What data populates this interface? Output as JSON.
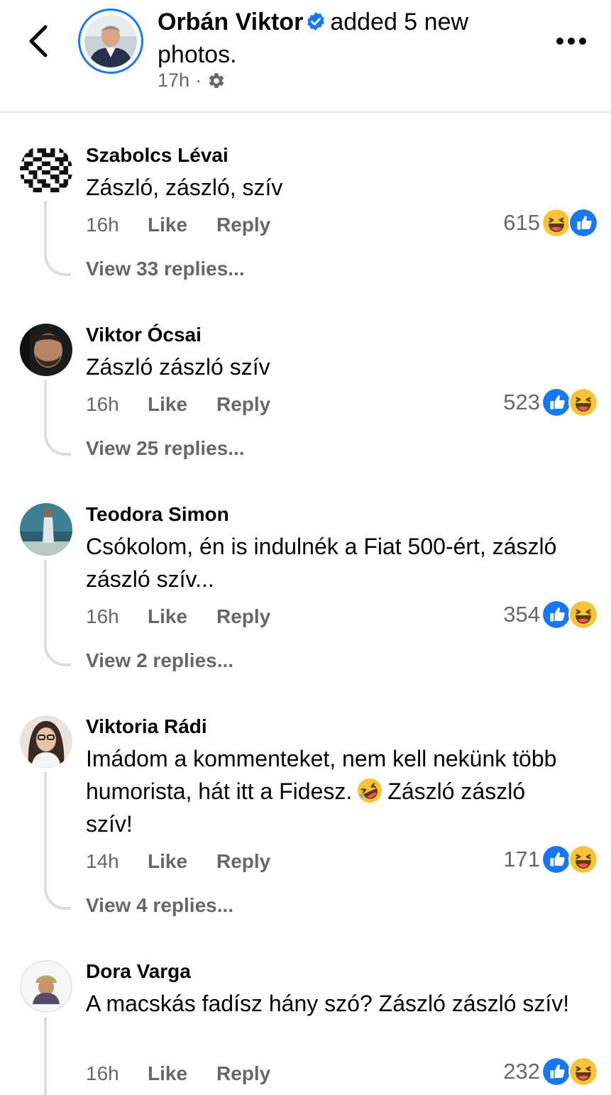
{
  "header": {
    "author": "Orbán Viktor",
    "action_text": "added 5 new photos.",
    "time": "17h",
    "separator": "·",
    "icons": [
      "back-chevron-icon",
      "verified-badge-icon",
      "audience-gear-icon",
      "more-dots-icon"
    ]
  },
  "colors": {
    "accent": "#1877f2",
    "secondary_text": "#65676b",
    "thread_line": "#dadde1"
  },
  "comments": [
    {
      "name": "Szabolcs Lévai",
      "text": "Zászló, zászló, szív",
      "time": "16h",
      "like": "Like",
      "reply": "Reply",
      "reactions": "615",
      "reaction_icons": [
        "haha",
        "like"
      ],
      "view_replies": "View 33 replies..."
    },
    {
      "name": "Viktor Ócsai",
      "text": "Zászló zászló szív",
      "time": "16h",
      "like": "Like",
      "reply": "Reply",
      "reactions": "523",
      "reaction_icons": [
        "like",
        "haha"
      ],
      "view_replies": "View 25 replies..."
    },
    {
      "name": "Teodora Simon",
      "text": "Csókolom, én is indulnék a Fiat 500-ért, zászló zászló szív...",
      "time": "16h",
      "like": "Like",
      "reply": "Reply",
      "reactions": "354",
      "reaction_icons": [
        "like",
        "haha"
      ],
      "view_replies": "View 2 replies..."
    },
    {
      "name": "Viktoria Rádi",
      "text_before_emoji": "Imádom a kommenteket, nem kell nekünk több humorista, hát itt a Fidesz.",
      "inline_emoji": "rolling-on-floor-laughing",
      "text_after_emoji": "Zászló zászló szív!",
      "time": "14h",
      "like": "Like",
      "reply": "Reply",
      "reactions": "171",
      "reaction_icons": [
        "like",
        "haha"
      ],
      "view_replies": "View 4 replies..."
    },
    {
      "name": "Dora Varga",
      "text": "A macskás fadísz hány szó? Zászló zászló szív!",
      "time": "16h",
      "like": "Like",
      "reply": "Reply",
      "reactions": "232",
      "reaction_icons": [
        "like",
        "haha"
      ]
    }
  ]
}
